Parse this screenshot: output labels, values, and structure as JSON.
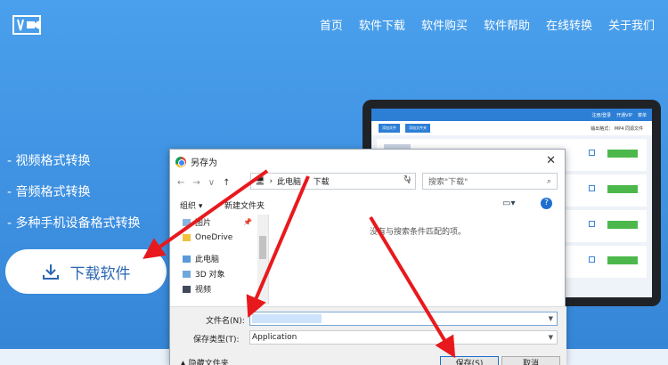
{
  "nav": [
    "首页",
    "软件下载",
    "软件购买",
    "软件帮助",
    "在线转换",
    "关于我们"
  ],
  "features": [
    "- 视频格式转换",
    "- 音频格式转换",
    "- 多种手机设备格式转换"
  ],
  "download_label": "下载软件",
  "laptop_app": {
    "top_items": [
      "注册/登录",
      "开通VIP",
      "菜单"
    ],
    "tool_buttons": [
      "添加文件",
      "添加文件夹"
    ],
    "format_label": "输出格式： MP4 同源文件"
  },
  "dialog": {
    "title": "另存为",
    "path": [
      "此电脑",
      "下载"
    ],
    "search_placeholder": "搜索\"下载\"",
    "organize_label": "组织 ▾",
    "new_folder_label": "新建文件夹",
    "nav_items": [
      {
        "label": "图片",
        "icon": "pictures-folder-icon"
      },
      {
        "label": "OneDrive",
        "icon": "onedrive-icon"
      },
      {
        "label": "此电脑",
        "icon": "computer-icon"
      },
      {
        "label": "3D 对象",
        "icon": "3d-objects-icon"
      },
      {
        "label": "视频",
        "icon": "video-folder-icon"
      }
    ],
    "empty_message": "没有与搜索条件匹配的项。",
    "filename_label": "文件名(N):",
    "filename_value": "",
    "type_label": "保存类型(T):",
    "type_value": "Application",
    "hide_folders_label": "▲ 隐藏文件夹",
    "save_label": "保存(S)",
    "cancel_label": "取消",
    "help_label": "?"
  },
  "colors": {
    "page_bg": "#3d8fe0",
    "arrow": "#e8191d",
    "accent": "#1d6fcf"
  }
}
